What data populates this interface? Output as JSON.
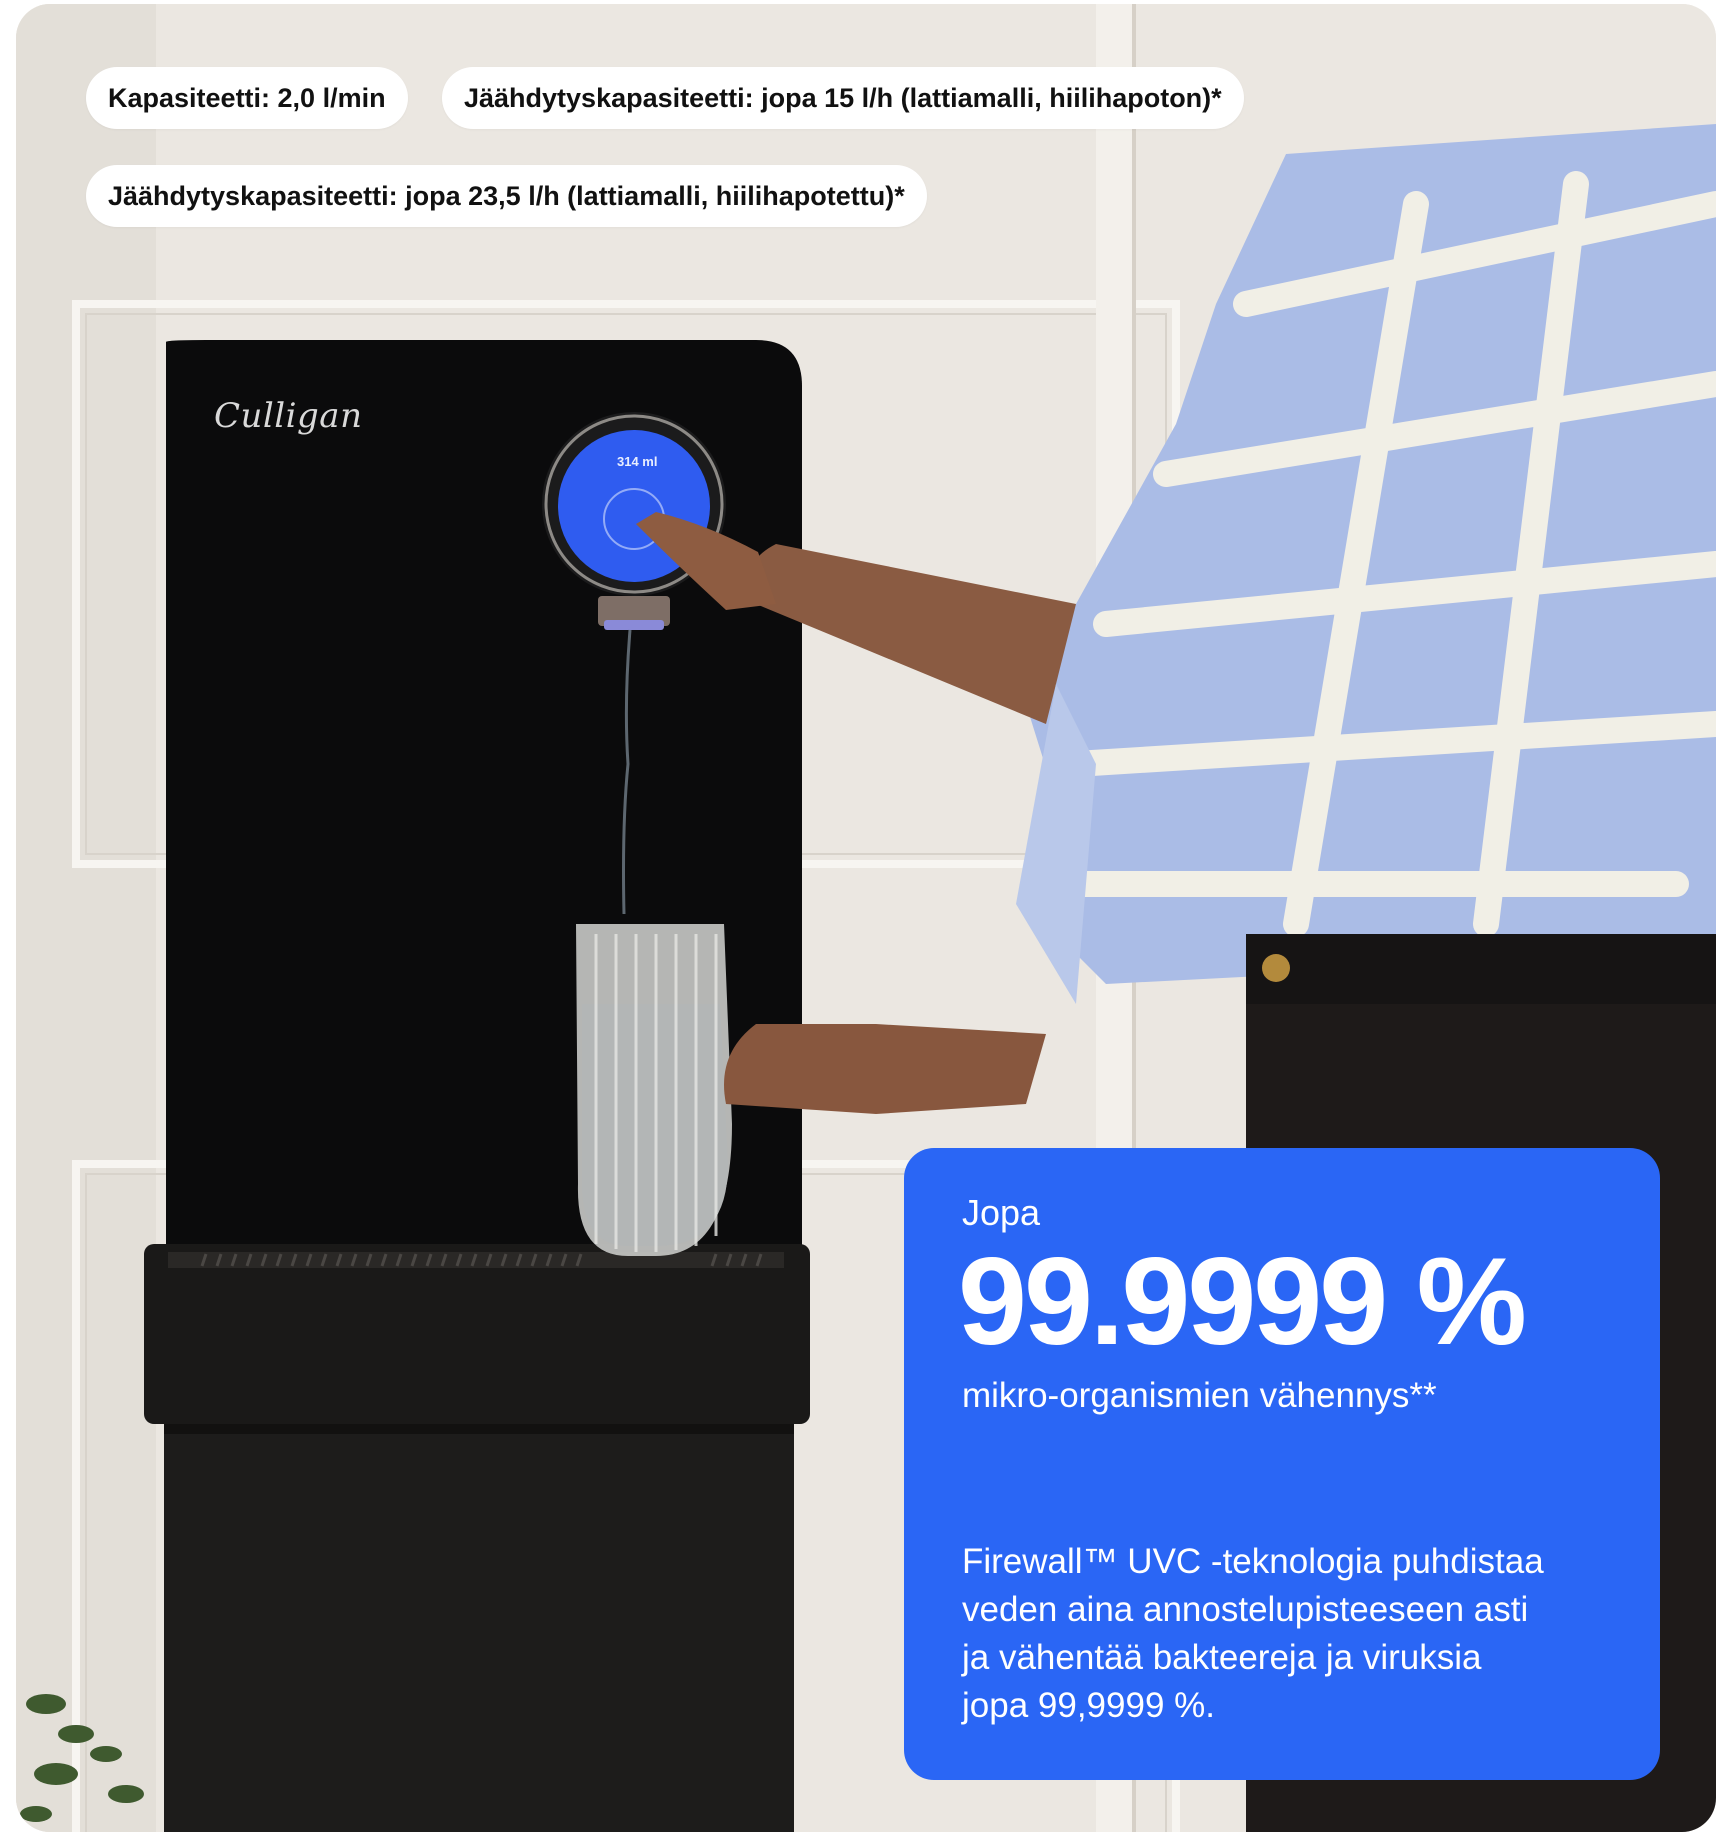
{
  "badges": {
    "capacity": "Kapasiteetti: 2,0 l/min",
    "cooling_still": "Jäähdytyskapasiteetti: jopa 15 l/h (lattiamalli, hiilihapoton)*",
    "cooling_sparkling": "Jäähdytyskapasiteetti: jopa 23,5 l/h (lattiamalli, hiilihapotettu)*"
  },
  "product": {
    "brand": "Culligan",
    "screen_readout": "314 ml"
  },
  "stat_card": {
    "kicker": "Jopa",
    "stat": "99.9999 %",
    "stat_label": "mikro-organismien vähennys**",
    "body_lines": [
      "Firewall™ UVC -teknologia puhdistaa",
      "veden aina annostelupisteeseen asti",
      "ja vähentää bakteereja ja viruksia",
      "jopa 99,9999 %."
    ],
    "background": "#2a66f5"
  },
  "colors": {
    "dispenser": "#0b0b0c",
    "screen": "#2f5cf0",
    "shirt": "#a9bce6",
    "wall": "#ece8e2"
  }
}
